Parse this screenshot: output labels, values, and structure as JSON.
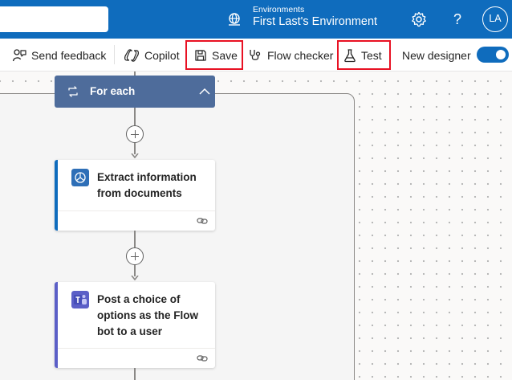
{
  "header": {
    "environment_caption": "Environments",
    "environment_name": "First Last's Environment",
    "avatar_initials": "LA",
    "help_label": "?"
  },
  "commands": {
    "send_feedback": "Send feedback",
    "copilot": "Copilot",
    "save": "Save",
    "flow_checker": "Flow checker",
    "test": "Test",
    "new_designer": "New designer",
    "new_designer_enabled": true
  },
  "flow": {
    "loop_title": "For each",
    "actions": [
      {
        "title": "Extract information from documents",
        "accent_color": "#0f6cbd",
        "icon": "ai-builder-icon"
      },
      {
        "title": "Post a choice of options as the Flow bot to a user",
        "accent_color": "#5b5fc7",
        "icon": "teams-icon"
      }
    ]
  },
  "colors": {
    "header_blue": "#0f6cbd",
    "loop_header": "#4e6c9b",
    "highlight_red": "#e81123"
  }
}
